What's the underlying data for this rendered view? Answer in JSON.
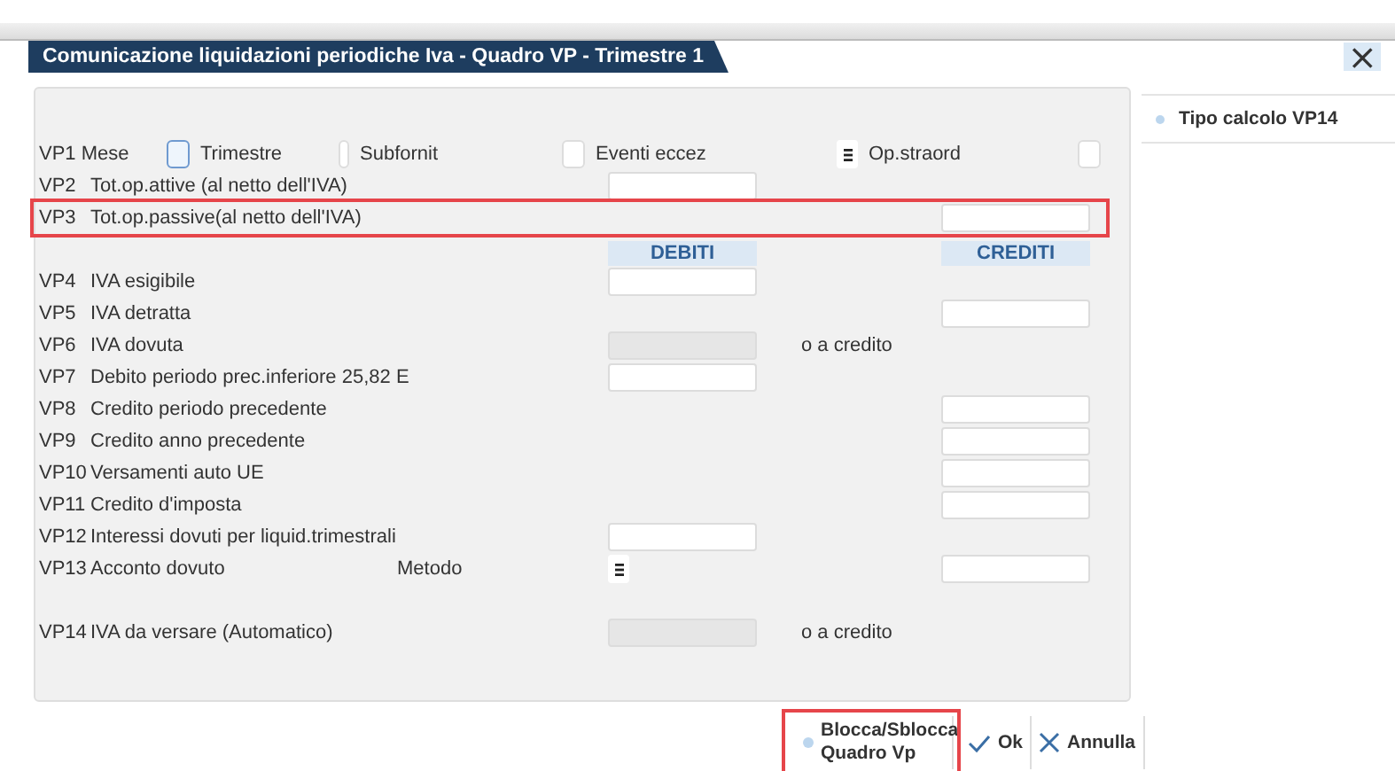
{
  "window": {
    "title": "Comunicazione liquidazioni periodiche Iva - Quadro VP - Trimestre 1",
    "close": "×"
  },
  "vp1": {
    "label": "VP1 Mese",
    "options": [
      {
        "kind": "checkbox",
        "label": "Trimestre",
        "checked": false
      },
      {
        "kind": "narrow",
        "label": "Subfornit",
        "checked": false
      },
      {
        "kind": "checkbox",
        "label": "Eventi eccez",
        "checked": false
      },
      {
        "kind": "menu",
        "label": "Op.straord"
      },
      {
        "kind": "checkbox",
        "checked": false
      }
    ]
  },
  "rows_top": [
    {
      "code": "VP2",
      "label": "Tot.op.attive (al netto dell'IVA)",
      "debit": {
        "kind": "input",
        "disabled": false
      },
      "highlighted": false
    },
    {
      "code": "VP3",
      "label": "Tot.op.passive(al netto dell'IVA)",
      "credit": {
        "kind": "input",
        "disabled": false
      },
      "highlighted": true
    }
  ],
  "headers": {
    "debit": "DEBITI",
    "credit": "CREDITI"
  },
  "rows": [
    {
      "code": "VP4",
      "label": "IVA esigibile",
      "debit": {
        "kind": "input",
        "disabled": false
      }
    },
    {
      "code": "VP5",
      "label": "IVA detratta",
      "credit": {
        "kind": "input",
        "disabled": false
      }
    },
    {
      "code": "VP6",
      "label": "IVA dovuta",
      "debit": {
        "kind": "input",
        "disabled": true
      },
      "note": "o a credito"
    },
    {
      "code": "VP7",
      "label": "Debito periodo prec.inferiore 25,82 E",
      "debit": {
        "kind": "input",
        "disabled": false
      }
    },
    {
      "code": "VP8",
      "label": "Credito periodo precedente",
      "credit": {
        "kind": "input",
        "disabled": false
      }
    },
    {
      "code": "VP9",
      "label": "Credito anno precedente",
      "credit": {
        "kind": "input",
        "disabled": false
      }
    },
    {
      "code": "VP10",
      "label": "Versamenti auto UE",
      "credit": {
        "kind": "input",
        "disabled": false
      }
    },
    {
      "code": "VP11",
      "label": "Credito d'imposta",
      "credit": {
        "kind": "input",
        "disabled": false
      }
    },
    {
      "code": "VP12",
      "label": "Interessi dovuti per liquid.trimestrali",
      "debit": {
        "kind": "input",
        "disabled": false
      }
    },
    {
      "code": "VP13",
      "label": "Acconto dovuto",
      "extra": "Metodo",
      "debit": {
        "kind": "menu"
      },
      "credit": {
        "kind": "input",
        "disabled": false
      }
    }
  ],
  "total_rows": [
    {
      "code": "VP14",
      "label": "IVA da versare (Automatico)",
      "debit": {
        "kind": "input",
        "disabled": true
      },
      "note": "o a credito"
    }
  ],
  "side_panel": {
    "items": [
      {
        "label": "Tipo calcolo VP14"
      }
    ]
  },
  "buttons": [
    {
      "kind": "dot",
      "label": "Blocca/Sblocca Quadro Vp",
      "highlighted": true
    },
    {
      "kind": "check",
      "label": "Ok",
      "highlighted": false
    },
    {
      "kind": "cross",
      "label": "Annulla",
      "highlighted": false
    }
  ]
}
